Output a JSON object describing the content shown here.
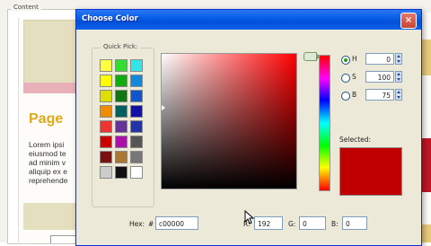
{
  "background": {
    "legend": "Content",
    "heading": "Page",
    "paragraph_lines": [
      "Lorem ipsi",
      "eiusmod te",
      "ad minim v",
      "aliquip ex e",
      "reprehende"
    ]
  },
  "dialog": {
    "title": "Choose Color",
    "close_label": "×",
    "quick_pick_label": "Quick Pick:",
    "quick_pick_colors": [
      "#ffff40",
      "#33dd33",
      "#33e6e6",
      "#ffff00",
      "#11aa11",
      "#1188dd",
      "#dede00",
      "#117711",
      "#1155cc",
      "#f08c00",
      "#006060",
      "#1111aa",
      "#ee3333",
      "#663399",
      "#2233aa",
      "#cc0000",
      "#aa11aa",
      "#555555",
      "#7a1111",
      "#aa7733",
      "#777777",
      "#cccccc",
      "#111111",
      "#ffffff"
    ],
    "hsb": [
      {
        "label": "H",
        "value": "0",
        "checked": true
      },
      {
        "label": "S",
        "value": "100",
        "checked": false
      },
      {
        "label": "B",
        "value": "75",
        "checked": false
      }
    ],
    "selected_label": "Selected:",
    "selected_color": "#c00000",
    "hex_label": "Hex:",
    "hex_hash": "#",
    "hex_value": "c00000",
    "r_label": "R:",
    "r_value": "192",
    "g_label": "G:",
    "g_value": "0",
    "b_label": "B:",
    "b_value": "0"
  }
}
